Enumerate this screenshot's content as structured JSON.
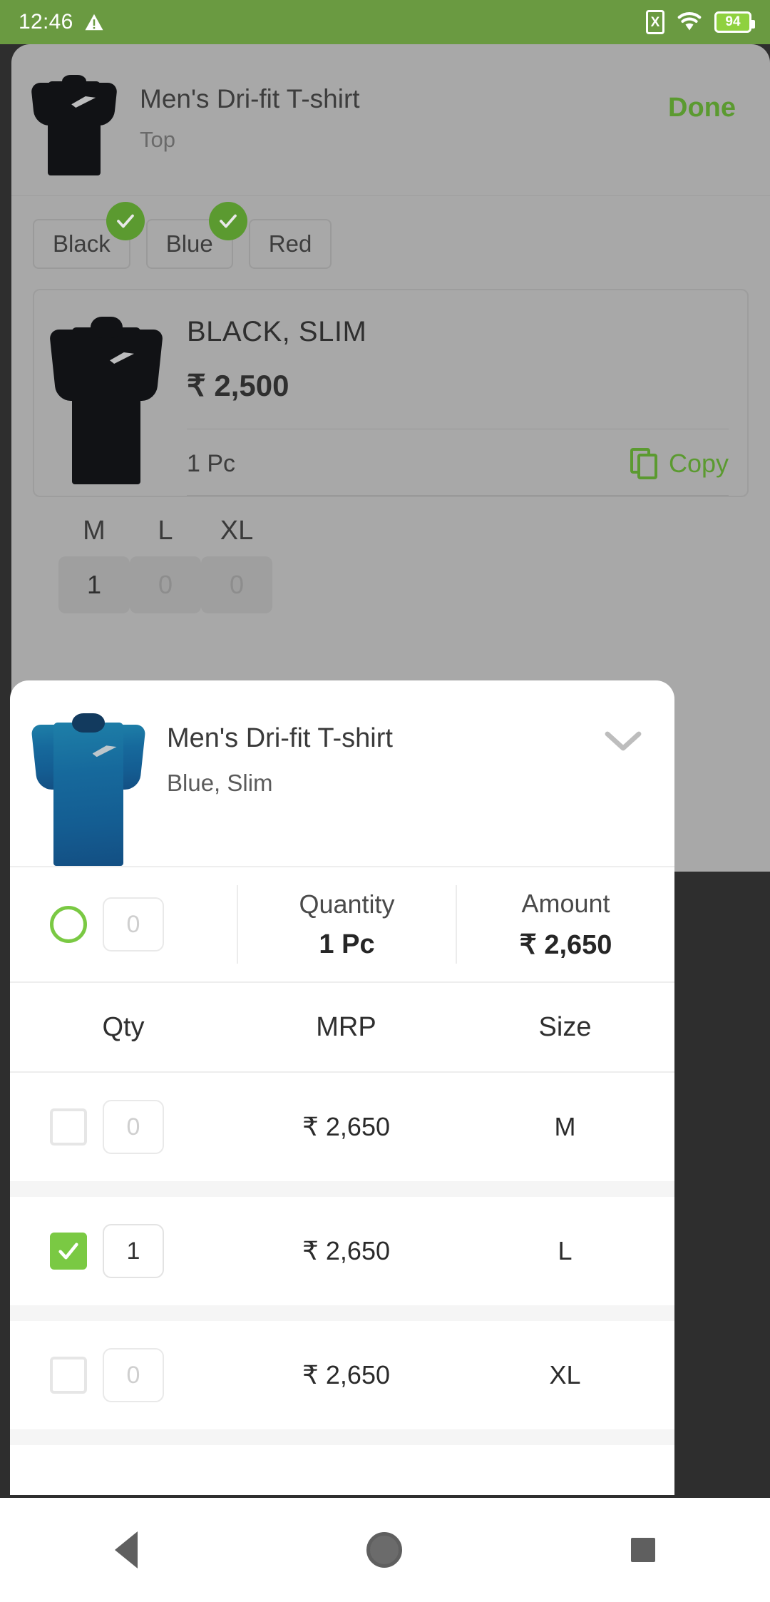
{
  "status_bar": {
    "time": "12:46",
    "warning_icon": "warning-triangle-icon",
    "sim_icon_label": "X",
    "wifi_icon": "wifi-icon",
    "battery_level": "94",
    "background_color": "#6a9a41"
  },
  "background_screen": {
    "product_title": "Men's Dri-fit T-shirt",
    "product_category": "Top",
    "done_label": "Done",
    "color_chips": [
      {
        "label": "Black",
        "selected": true
      },
      {
        "label": "Blue",
        "selected": true
      },
      {
        "label": "Red",
        "selected": false
      }
    ],
    "variant_card": {
      "variant": "BLACK, SLIM",
      "price": "₹ 2,500",
      "pieces": "1 Pc",
      "copy_label": "Copy"
    },
    "size_headers": [
      "M",
      "L",
      "XL"
    ],
    "size_values": [
      "1",
      "0",
      "0"
    ]
  },
  "sheet": {
    "product_title": "Men's Dri-fit T-shirt",
    "variant": "Blue, Slim",
    "collapse_icon": "chevron-down-icon",
    "summary": {
      "select_all_placeholder": "0",
      "quantity_label": "Quantity",
      "quantity_value": "1 Pc",
      "amount_label": "Amount",
      "amount_value": "₹ 2,650"
    },
    "columns": {
      "qty": "Qty",
      "mrp": "MRP",
      "size": "Size"
    },
    "rows": [
      {
        "checked": false,
        "qty": "0",
        "mrp": "₹ 2,650",
        "size": "M"
      },
      {
        "checked": true,
        "qty": "1",
        "mrp": "₹ 2,650",
        "size": "L"
      },
      {
        "checked": false,
        "qty": "0",
        "mrp": "₹ 2,650",
        "size": "XL"
      }
    ]
  },
  "nav_bar": {
    "back_icon": "triangle-back-icon",
    "home_icon": "circle-home-icon",
    "recents_icon": "square-recents-icon"
  },
  "colors": {
    "accent_green": "#5b9a30",
    "check_green": "#7ac943",
    "status_green": "#6a9a41"
  }
}
